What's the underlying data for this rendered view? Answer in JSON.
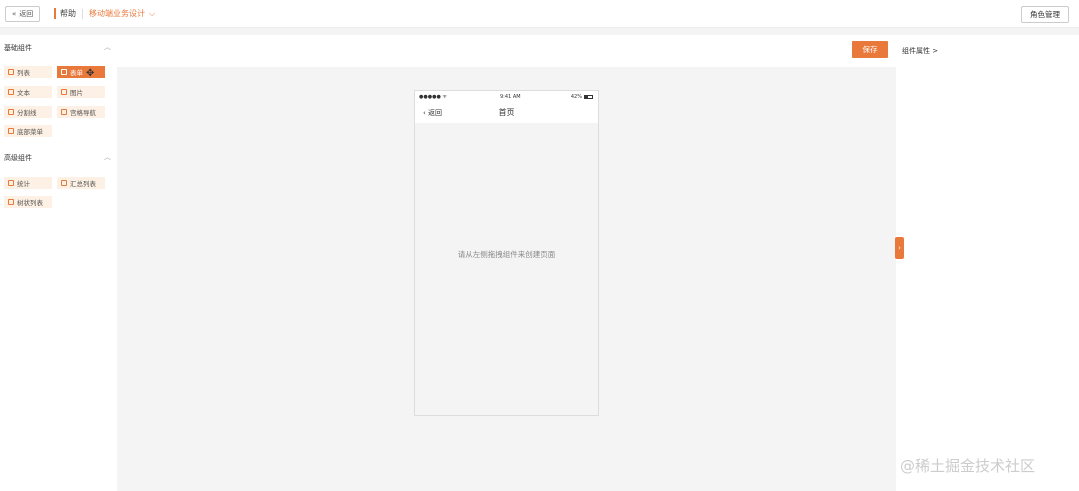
{
  "header": {
    "back_label": "返回",
    "help_label": "帮助",
    "project_name": "移动端业务设计",
    "role_button": "角色管理"
  },
  "sidebar": {
    "basic_title": "基础组件",
    "basic_items": [
      "列表",
      "表单",
      "文本",
      "图片",
      "分割线",
      "宫格导航",
      "底部菜单"
    ],
    "advanced_title": "高级组件",
    "advanced_items": [
      "统计",
      "汇总列表",
      "树状列表"
    ]
  },
  "toolbar": {
    "save_label": "保存"
  },
  "phone": {
    "carrier": "●●●●● ᯤ",
    "time": "9:41 AM",
    "battery": "42%",
    "back": "返回",
    "title": "首页",
    "empty_hint": "请从左侧拖拽组件来创建页面"
  },
  "panel": {
    "title": "组件属性 >"
  },
  "watermark": "@稀土掘金技术社区",
  "colors": {
    "accent": "#e8793b"
  }
}
